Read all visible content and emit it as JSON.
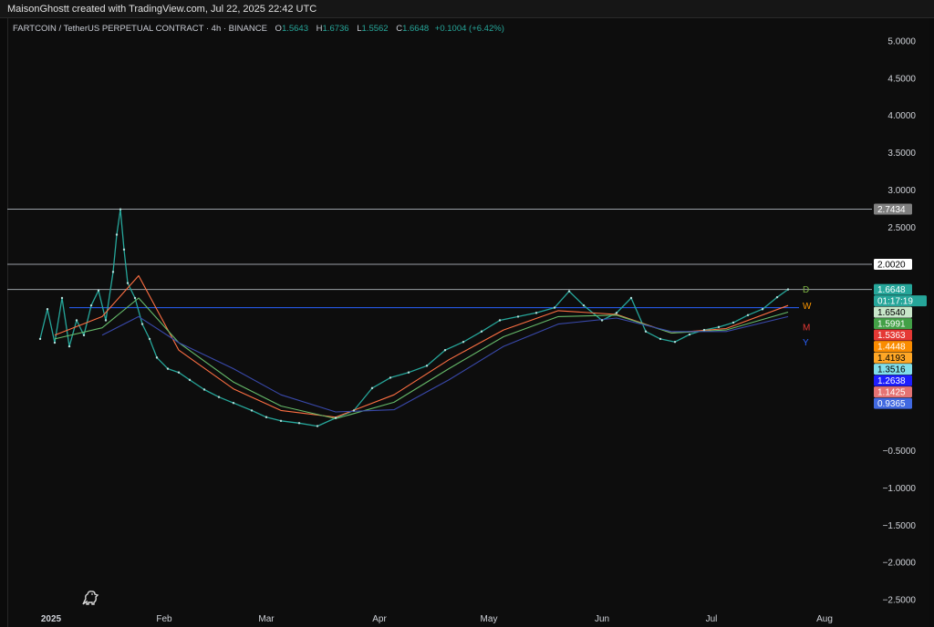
{
  "header": {
    "attribution": "MaisonGhostt created with TradingView.com, Jul 22, 2025 22:42 UTC"
  },
  "legend": {
    "symbol": "FARTCOIN / TetherUS PERPETUAL CONTRACT · 4h · BINANCE",
    "o_label": "O",
    "o_value": "1.5643",
    "h_label": "H",
    "h_value": "1.6736",
    "l_label": "L",
    "l_value": "1.5562",
    "c_label": "C",
    "c_value": "1.6648",
    "change": "+0.1004 (+6.42%)"
  },
  "colors": {
    "up": "#26a69a",
    "ema_fast": "#ff7043",
    "ema_mid": "#66bb6a",
    "ema_slow": "#3949ab",
    "level_line": "#9aa0a6",
    "y_line": "#2962ff"
  },
  "chart_data": {
    "type": "line",
    "title": "FARTCOIN / TetherUS PERPETUAL CONTRACT · 4h · BINANCE",
    "y_axis_ticks": [
      "5.0000",
      "4.5000",
      "4.0000",
      "3.5000",
      "3.0000",
      "2.5000",
      "−0.5000",
      "−1.0000",
      "−1.5000",
      "−2.0000",
      "−2.5000"
    ],
    "y_axis_tick_values": [
      5.0,
      4.5,
      4.0,
      3.5,
      3.0,
      2.5,
      -0.5,
      -1.0,
      -1.5,
      -2.0,
      -2.5
    ],
    "x_axis_ticks": [
      "2025",
      "Feb",
      "Mar",
      "Apr",
      "May",
      "Jun",
      "Jul",
      "Aug"
    ],
    "x_axis_tick_values": [
      "2025-01-01",
      "2025-02-01",
      "2025-03-01",
      "2025-04-01",
      "2025-05-01",
      "2025-06-01",
      "2025-07-01",
      "2025-08-01"
    ],
    "ylim": [
      -2.75,
      5.2
    ],
    "xlim": [
      "2024-12-20",
      "2025-08-14"
    ],
    "horizontal_levels": [
      2.7434,
      2.002,
      1.6648,
      1.4193
    ],
    "price_tags": [
      {
        "text": "2.7434",
        "value": 2.7434,
        "bg": "#808080",
        "fg": "#ffffff"
      },
      {
        "text": "2.0020",
        "value": 2.002,
        "bg": "#ffffff",
        "fg": "#000000"
      },
      {
        "text": "1.6648",
        "value": 1.6648,
        "bg": "#26a69a",
        "fg": "#ffffff"
      },
      {
        "text": "01:17:19",
        "value": 1.6648,
        "bg": "#26a69a",
        "fg": "#ffffff"
      },
      {
        "text": "1.6540",
        "value": 1.654,
        "bg": "#c8e6c9",
        "fg": "#000000"
      },
      {
        "text": "1.5991",
        "value": 1.5991,
        "bg": "#43a047",
        "fg": "#ffffff"
      },
      {
        "text": "1.5363",
        "value": 1.5363,
        "bg": "#e53935",
        "fg": "#ffffff"
      },
      {
        "text": "1.4448",
        "value": 1.4448,
        "bg": "#fb8c00",
        "fg": "#ffffff"
      },
      {
        "text": "1.4193",
        "value": 1.4193,
        "bg": "#ffa726",
        "fg": "#000000"
      },
      {
        "text": "1.3516",
        "value": 1.3516,
        "bg": "#80deea",
        "fg": "#000000"
      },
      {
        "text": "1.2638",
        "value": 1.2638,
        "bg": "#1e1eff",
        "fg": "#ffffff"
      },
      {
        "text": "1.1425",
        "value": 1.1425,
        "bg": "#e57373",
        "fg": "#ffffff"
      },
      {
        "text": "0.9365",
        "value": 0.9365,
        "bg": "#4169e1",
        "fg": "#ffffff"
      }
    ],
    "level_markers": [
      {
        "text": "D",
        "value": 1.66,
        "color": "#7cb342"
      },
      {
        "text": "W",
        "value": 1.44,
        "color": "#ff9800"
      },
      {
        "text": "M",
        "value": 1.15,
        "color": "#e53935"
      },
      {
        "text": "Y",
        "value": 0.95,
        "color": "#2962ff"
      }
    ],
    "series": [
      {
        "role": "price",
        "x": [
          "2024-12-29",
          "2024-12-31",
          "2025-01-02",
          "2025-01-04",
          "2025-01-06",
          "2025-01-08",
          "2025-01-10",
          "2025-01-12",
          "2025-01-14",
          "2025-01-16",
          "2025-01-18",
          "2025-01-19",
          "2025-01-20",
          "2025-01-21",
          "2025-01-22",
          "2025-01-24",
          "2025-01-26",
          "2025-01-28",
          "2025-01-30",
          "2025-02-02",
          "2025-02-05",
          "2025-02-08",
          "2025-02-12",
          "2025-02-16",
          "2025-02-20",
          "2025-02-25",
          "2025-03-01",
          "2025-03-05",
          "2025-03-10",
          "2025-03-15",
          "2025-03-20",
          "2025-03-25",
          "2025-03-30",
          "2025-04-04",
          "2025-04-09",
          "2025-04-14",
          "2025-04-19",
          "2025-04-24",
          "2025-04-29",
          "2025-05-04",
          "2025-05-09",
          "2025-05-14",
          "2025-05-19",
          "2025-05-23",
          "2025-05-27",
          "2025-06-01",
          "2025-06-05",
          "2025-06-09",
          "2025-06-13",
          "2025-06-17",
          "2025-06-21",
          "2025-06-25",
          "2025-06-29",
          "2025-07-03",
          "2025-07-07",
          "2025-07-11",
          "2025-07-15",
          "2025-07-19",
          "2025-07-22"
        ],
        "y": [
          1.0,
          1.4,
          0.95,
          1.55,
          0.9,
          1.25,
          1.05,
          1.45,
          1.65,
          1.25,
          1.9,
          2.4,
          2.74,
          2.2,
          1.75,
          1.55,
          1.2,
          1.0,
          0.75,
          0.6,
          0.55,
          0.45,
          0.32,
          0.22,
          0.14,
          0.04,
          -0.05,
          -0.1,
          -0.13,
          -0.17,
          -0.06,
          0.04,
          0.34,
          0.48,
          0.55,
          0.64,
          0.85,
          0.96,
          1.1,
          1.25,
          1.3,
          1.35,
          1.42,
          1.64,
          1.45,
          1.25,
          1.35,
          1.55,
          1.1,
          1.0,
          0.96,
          1.06,
          1.12,
          1.16,
          1.22,
          1.32,
          1.4,
          1.56,
          1.6648
        ]
      },
      {
        "role": "ema-fast",
        "x": [
          "2025-01-02",
          "2025-01-15",
          "2025-01-25",
          "2025-02-05",
          "2025-02-20",
          "2025-03-05",
          "2025-03-20",
          "2025-04-05",
          "2025-04-20",
          "2025-05-05",
          "2025-05-20",
          "2025-06-05",
          "2025-06-20",
          "2025-07-05",
          "2025-07-22"
        ],
        "y": [
          1.05,
          1.3,
          1.85,
          0.85,
          0.33,
          0.04,
          -0.05,
          0.25,
          0.72,
          1.12,
          1.38,
          1.33,
          1.08,
          1.14,
          1.45
        ]
      },
      {
        "role": "ema-mid",
        "x": [
          "2025-01-02",
          "2025-01-15",
          "2025-01-25",
          "2025-02-05",
          "2025-02-20",
          "2025-03-05",
          "2025-03-20",
          "2025-04-05",
          "2025-04-20",
          "2025-05-05",
          "2025-05-20",
          "2025-06-05",
          "2025-06-20",
          "2025-07-05",
          "2025-07-22"
        ],
        "y": [
          1.0,
          1.15,
          1.55,
          0.95,
          0.42,
          0.1,
          -0.07,
          0.15,
          0.6,
          1.03,
          1.3,
          1.32,
          1.08,
          1.12,
          1.36
        ]
      },
      {
        "role": "ema-slow",
        "x": [
          "2025-01-15",
          "2025-01-25",
          "2025-02-05",
          "2025-02-20",
          "2025-03-05",
          "2025-03-20",
          "2025-04-05",
          "2025-04-20",
          "2025-05-05",
          "2025-05-20",
          "2025-06-05",
          "2025-06-20",
          "2025-07-05",
          "2025-07-22"
        ],
        "y": [
          1.05,
          1.3,
          0.95,
          0.6,
          0.25,
          0.02,
          0.05,
          0.45,
          0.9,
          1.2,
          1.28,
          1.1,
          1.1,
          1.3
        ]
      }
    ]
  }
}
